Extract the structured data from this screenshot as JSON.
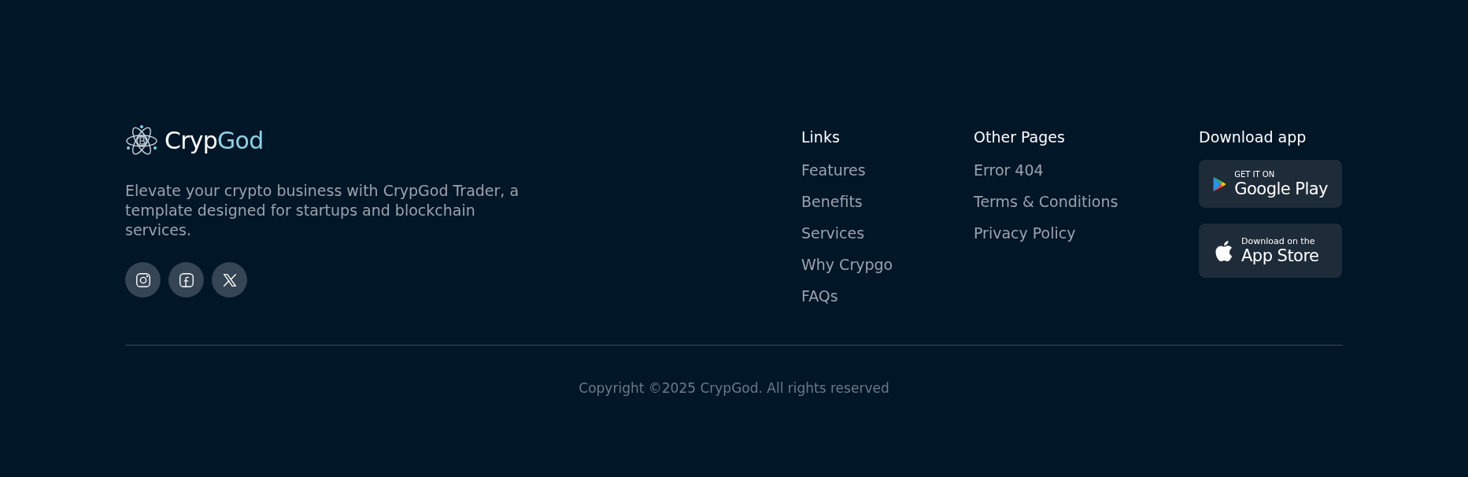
{
  "brand": {
    "first": "Cryp",
    "second": "God"
  },
  "description": "Elevate your crypto business with CrypGod Trader, a template designed for startups and blockchain services.",
  "socials": [
    {
      "kind": "instagram"
    },
    {
      "kind": "facebook"
    },
    {
      "kind": "x"
    }
  ],
  "columns": [
    {
      "title": "Links",
      "items": [
        "Features",
        "Benefits",
        "Services",
        "Why Crypgo",
        "FAQs"
      ]
    },
    {
      "title": "Other Pages",
      "items": [
        "Error 404",
        "Terms & Conditions",
        "Privacy Policy"
      ]
    }
  ],
  "download": {
    "title": "Download app",
    "badges": [
      {
        "kind": "google",
        "small": "GET IT ON",
        "big": "Google Play"
      },
      {
        "kind": "apple",
        "small": "Download on the",
        "big": "App Store"
      }
    ]
  },
  "copyright": "Copyright ©2025 CrypGod. All rights reserved"
}
